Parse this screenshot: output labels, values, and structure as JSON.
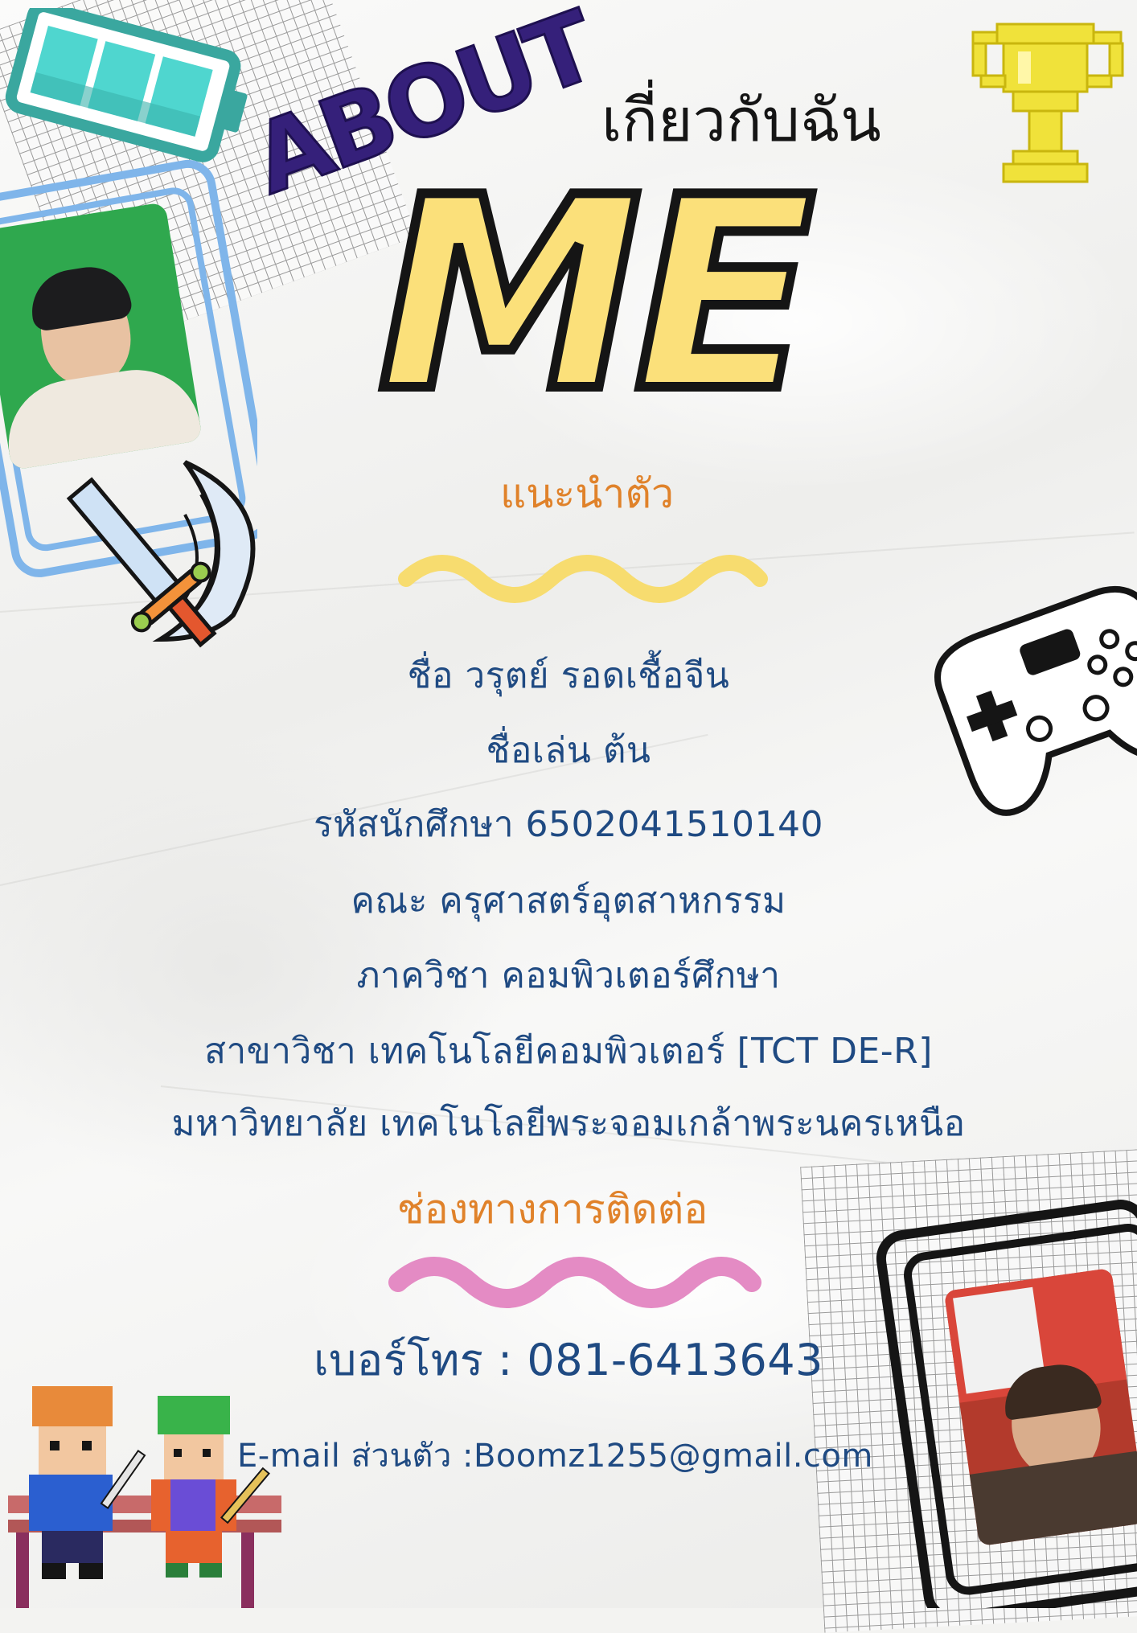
{
  "header": {
    "about_label": "ABOUT",
    "thai_about": "เกี่ยวกับฉัน",
    "me_label": "ME",
    "subtitle": "แนะนำตัว"
  },
  "profile": {
    "name_line": "ชื่อ วรุตย์ รอดเชื้อจีน",
    "nickname_line": "ชื่อเล่น ต้น",
    "student_id_line": "รหัสนักศึกษา 6502041510140",
    "faculty_line": "คณะ ครุศาสตร์อุตสาหกรรม",
    "department_line": "ภาควิชา คอมพิวเตอร์ศึกษา",
    "major_line": "สาขาวิชา เทคโนโลยีคอมพิวเตอร์ [TCT DE-R]",
    "university_line": "มหาวิทยาลัย เทคโนโลยีพระจอมเกล้าพระนครเหนือ"
  },
  "contact": {
    "heading": "ช่องทางการติดต่อ",
    "phone_line": "เบอร์โทร :  081-6413643",
    "email_line": "E-mail ส่วนตัว :Boomz1255@gmail.com"
  },
  "colors": {
    "navy_text": "#1f4a82",
    "orange_heading": "#e0822a",
    "about_purple": "#35207a",
    "me_yellow": "#fbe07a",
    "wave_yellow": "#f7dc6f",
    "wave_pink": "#e48bc4",
    "frame_blue": "#7fb5ea",
    "battery_teal": "#4fd6cf",
    "trophy_yellow": "#f0e23a"
  },
  "icons": [
    "battery-icon",
    "trophy-icon",
    "sword-icon",
    "game-controller-icon",
    "pixel-characters-icon",
    "photo-frame-icon"
  ]
}
